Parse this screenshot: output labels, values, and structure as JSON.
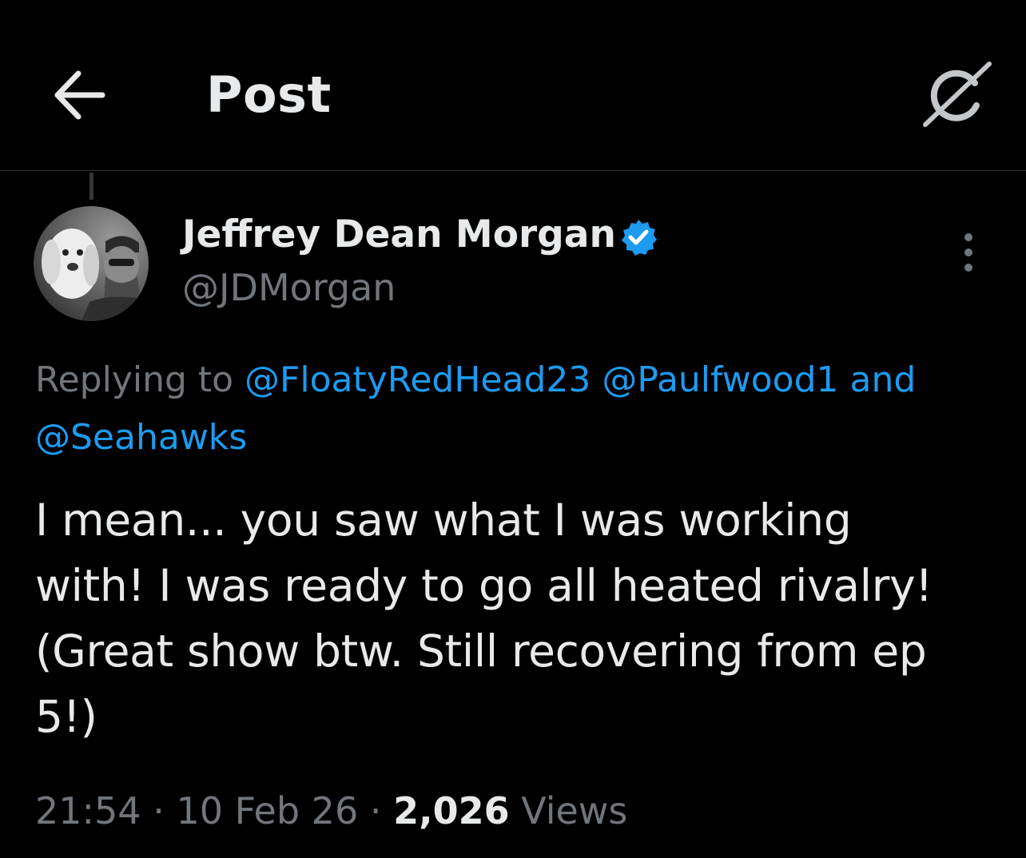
{
  "header": {
    "title": "Post",
    "back_icon": "arrow-left-icon",
    "grok_icon": "grok-icon"
  },
  "author": {
    "name": "Jeffrey Dean Morgan",
    "handle": "@JDMorgan",
    "verified": true,
    "verified_color": "#1d9bf0"
  },
  "reply": {
    "prefix": "Replying to ",
    "mentions": [
      "@FloatyRedHead23",
      "@Paulfwood1",
      "@Seahawks"
    ],
    "and_word": "and"
  },
  "tweet": {
    "text": "I mean... you saw what I was working\nwith! I was ready to go all heated rivalry!\n(Great show btw. Still recovering from ep\n5!)"
  },
  "meta": {
    "time": "21:54",
    "separator": "·",
    "date": "10 Feb 26",
    "views_count": "2,026",
    "views_label": "Views"
  },
  "colors": {
    "background": "#000000",
    "text_primary": "#e7e9ea",
    "text_secondary": "#71767b",
    "accent": "#1d9bf0",
    "divider": "#2f3336"
  }
}
